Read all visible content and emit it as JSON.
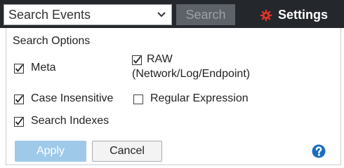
{
  "toolbar": {
    "search_select_value": "Search Events",
    "search_button_label": "Search",
    "settings_label": "Settings",
    "settings_icon": "gear-icon",
    "settings_icon_color": "#e2332b"
  },
  "options_panel": {
    "heading": "Search Options",
    "options": [
      {
        "label": "Meta",
        "checked": true
      },
      {
        "label_line1": "RAW",
        "label_line2": "(Network/Log/Endpoint)",
        "checked": true
      },
      {
        "label": "Case Insensitive",
        "checked": true
      },
      {
        "label": "Regular Expression",
        "checked": false
      },
      {
        "label": "Search Indexes",
        "checked": true
      }
    ],
    "apply_label": "Apply",
    "cancel_label": "Cancel",
    "help_icon": "question-circle-icon",
    "help_icon_color": "#1a6fc0"
  }
}
